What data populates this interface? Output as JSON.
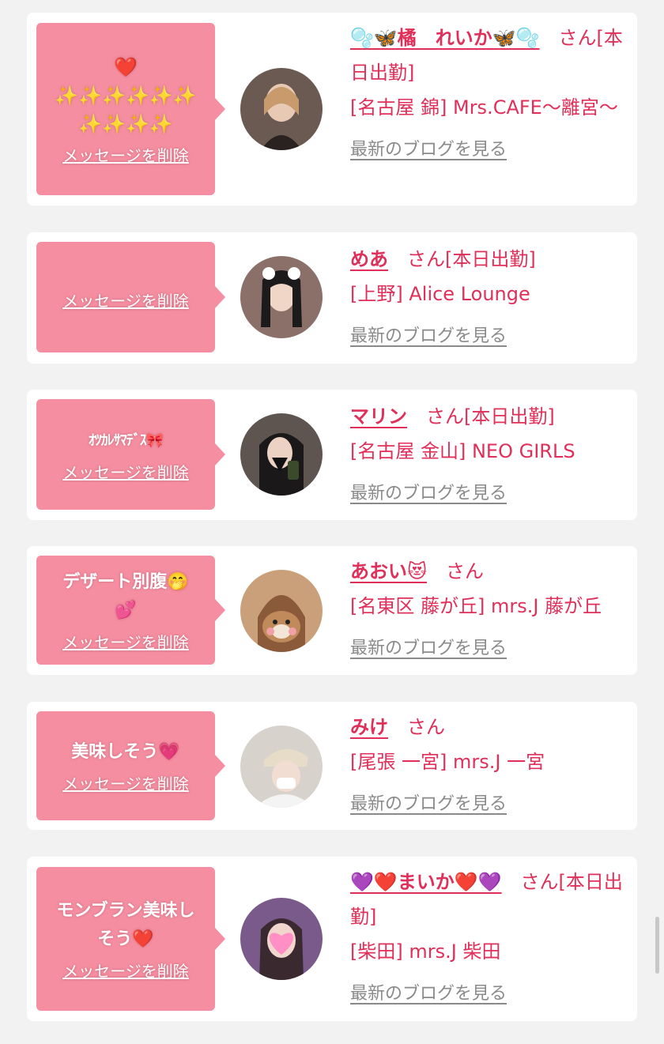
{
  "entries": [
    {
      "message": "❤️\n✨✨✨✨✨✨\n✨✨✨✨",
      "delete_label": "メッセージを削除",
      "name": "🫧🦋橘　れいか🦋🫧",
      "suffix": "　さん[本日出勤]",
      "shop": "[名古屋 錦] Mrs.CAFE〜離宮〜",
      "blog_label": "最新のブログを見る",
      "avatar_color": "#6b5a52"
    },
    {
      "message": "",
      "delete_label": "メッセージを削除",
      "name": "めあ",
      "suffix": "　さん[本日出勤]",
      "shop": "[上野] Alice Lounge",
      "blog_label": "最新のブログを見る",
      "avatar_color": "#8a7068"
    },
    {
      "message": "ｵﾂｶﾚｻﾏﾃﾞｽ🎀",
      "delete_label": "メッセージを削除",
      "name": "マリン",
      "suffix": "　さん[本日出勤]",
      "shop": "[名古屋 金山] NEO GIRLS",
      "blog_label": "最新のブログを見る",
      "avatar_color": "#5e5450"
    },
    {
      "message": "デザート別腹🤭\n💕",
      "delete_label": "メッセージを削除",
      "name": "あおい😻",
      "suffix": "　さん",
      "shop": "[名東区 藤が丘] mrs.J 藤が丘",
      "blog_label": "最新のブログを見る",
      "avatar_color": "#c9a07a"
    },
    {
      "message": "美味しそう💗",
      "delete_label": "メッセージを削除",
      "name": "みけ",
      "suffix": "　さん",
      "shop": "[尾張 一宮] mrs.J 一宮",
      "blog_label": "最新のブログを見る",
      "avatar_color": "#d8d2cc"
    },
    {
      "message": "モンブラン美味し\nそう❤️",
      "delete_label": "メッセージを削除",
      "name": "💜❤️まいか❤️💜",
      "suffix": "　さん[本日出勤]",
      "shop": "[柴田] mrs.J 柴田",
      "blog_label": "最新のブログを見る",
      "avatar_color": "#7a5a8a"
    }
  ],
  "colors": {
    "accent": "#e0305a",
    "bubble": "#f48ea0",
    "link_gray": "#8a8a8a",
    "background": "#f2f2f2"
  }
}
